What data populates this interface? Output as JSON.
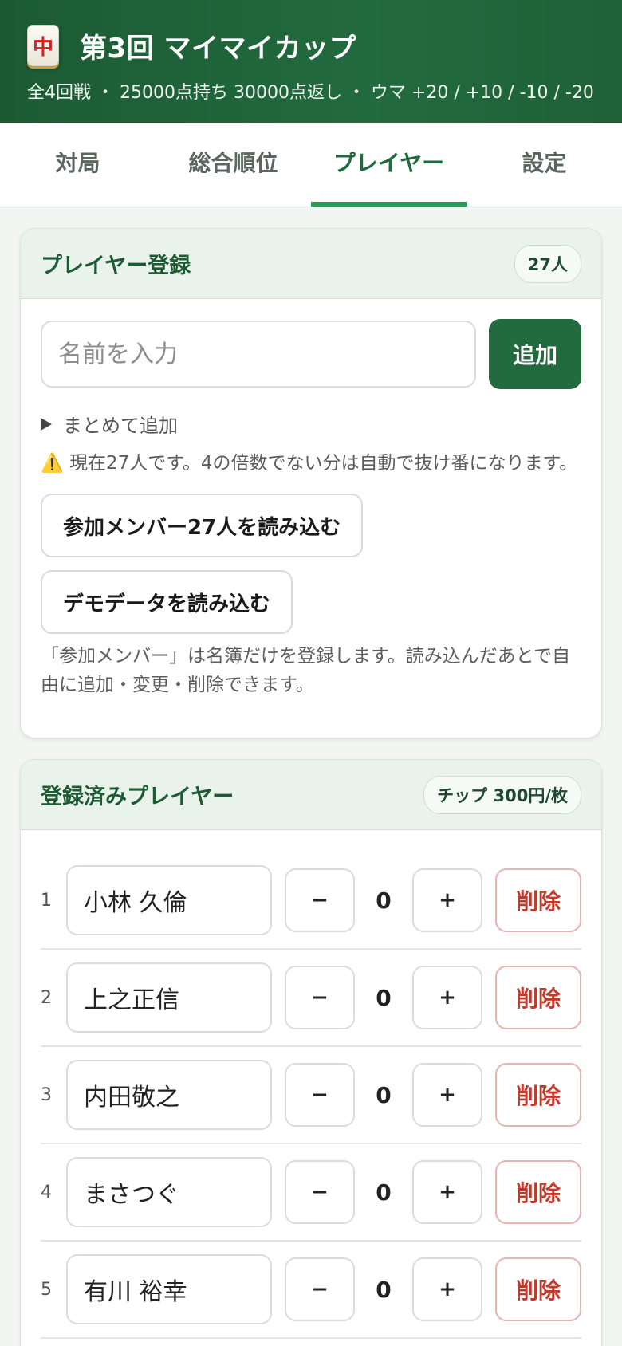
{
  "header": {
    "tile_glyph": "中",
    "title": "第3回 マイマイカップ",
    "subtitle": "全4回戦 ・ 25000点持ち 30000点返し ・ ウマ +20 / +10 / -10 / -20"
  },
  "tabs": [
    {
      "label": "対局",
      "active": false
    },
    {
      "label": "総合順位",
      "active": false
    },
    {
      "label": "プレイヤー",
      "active": true
    },
    {
      "label": "設定",
      "active": false
    }
  ],
  "register": {
    "title": "プレイヤー登録",
    "count_badge": "27人",
    "name_placeholder": "名前を入力",
    "add_label": "追加",
    "bulk_label": "まとめて追加",
    "warning_icon": "⚠️",
    "warning_text": "現在27人です。4の倍数でない分は自動で抜け番になります。",
    "load_members_label": "参加メンバー27人を読み込む",
    "load_demo_label": "デモデータを読み込む",
    "note": "「参加メンバー」は名簿だけを登録します。読み込んだあとで自由に追加・変更・削除できます。"
  },
  "registered": {
    "title": "登録済みプレイヤー",
    "chip_badge": "チップ 300円/枚",
    "minus_label": "−",
    "plus_label": "+",
    "delete_label": "削除",
    "players": [
      {
        "num": "1",
        "name": "小林 久倫",
        "chips": "0"
      },
      {
        "num": "2",
        "name": "上之正信",
        "chips": "0"
      },
      {
        "num": "3",
        "name": "内田敬之",
        "chips": "0"
      },
      {
        "num": "4",
        "name": "まさつぐ",
        "chips": "0"
      },
      {
        "num": "5",
        "name": "有川 裕幸",
        "chips": "0"
      }
    ]
  },
  "colors": {
    "brand": "#226b3e",
    "accent_tab": "#2e9a5b",
    "danger": "#c0392b"
  }
}
